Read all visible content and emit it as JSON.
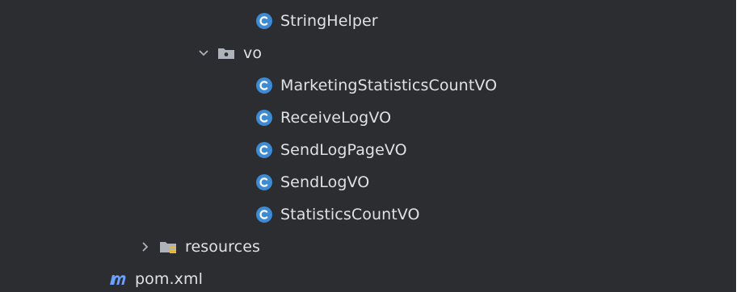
{
  "colors": {
    "panel_background": "#2b2d30",
    "text": "#dfe1e5",
    "class_icon": "#3d8bd4",
    "folder_icon": "#aeb3bb",
    "maven_icon": "#6aa0ff",
    "chevron": "#aeb3bb"
  },
  "tree": {
    "items": [
      {
        "label": "StringHelper",
        "icon": "class-icon"
      },
      {
        "label": "vo",
        "icon": "package-folder-icon",
        "expanded": true
      },
      {
        "label": "MarketingStatisticsCountVO",
        "icon": "class-icon"
      },
      {
        "label": "ReceiveLogVO",
        "icon": "class-icon"
      },
      {
        "label": "SendLogPageVO",
        "icon": "class-icon"
      },
      {
        "label": "SendLogVO",
        "icon": "class-icon"
      },
      {
        "label": "StatisticsCountVO",
        "icon": "class-icon"
      },
      {
        "label": "resources",
        "icon": "resources-folder-icon",
        "expanded": false
      },
      {
        "label": "pom.xml",
        "icon": "maven-icon"
      }
    ]
  }
}
